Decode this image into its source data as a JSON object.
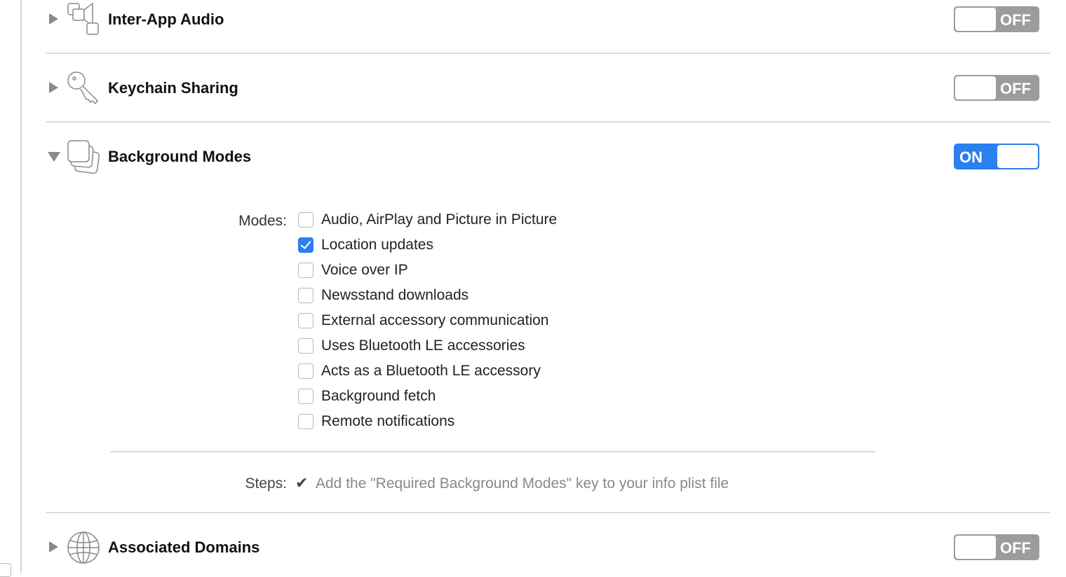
{
  "capabilities": [
    {
      "title": "Inter-App Audio",
      "icon": "inter-app-audio-icon",
      "expanded": false,
      "enabled": false,
      "toggle_label": "OFF"
    },
    {
      "title": "Keychain Sharing",
      "icon": "key-icon",
      "expanded": false,
      "enabled": false,
      "toggle_label": "OFF"
    },
    {
      "title": "Background Modes",
      "icon": "background-modes-icon",
      "expanded": true,
      "enabled": true,
      "toggle_label": "ON"
    },
    {
      "title": "Associated Domains",
      "icon": "globe-icon",
      "expanded": false,
      "enabled": false,
      "toggle_label": "OFF"
    }
  ],
  "background_modes": {
    "modes_label": "Modes:",
    "modes": [
      {
        "label": "Audio, AirPlay and Picture in Picture",
        "checked": false
      },
      {
        "label": "Location updates",
        "checked": true
      },
      {
        "label": "Voice over IP",
        "checked": false
      },
      {
        "label": "Newsstand downloads",
        "checked": false
      },
      {
        "label": "External accessory communication",
        "checked": false
      },
      {
        "label": "Uses Bluetooth LE accessories",
        "checked": false
      },
      {
        "label": "Acts as a Bluetooth LE accessory",
        "checked": false
      },
      {
        "label": "Background fetch",
        "checked": false
      },
      {
        "label": "Remote notifications",
        "checked": false
      }
    ],
    "steps_label": "Steps:",
    "steps": [
      {
        "text": "Add the \"Required Background Modes\" key to your info plist file",
        "done": true
      }
    ]
  },
  "colors": {
    "accent": "#2b7ff0",
    "toggle_off": "#9c9c9c"
  }
}
